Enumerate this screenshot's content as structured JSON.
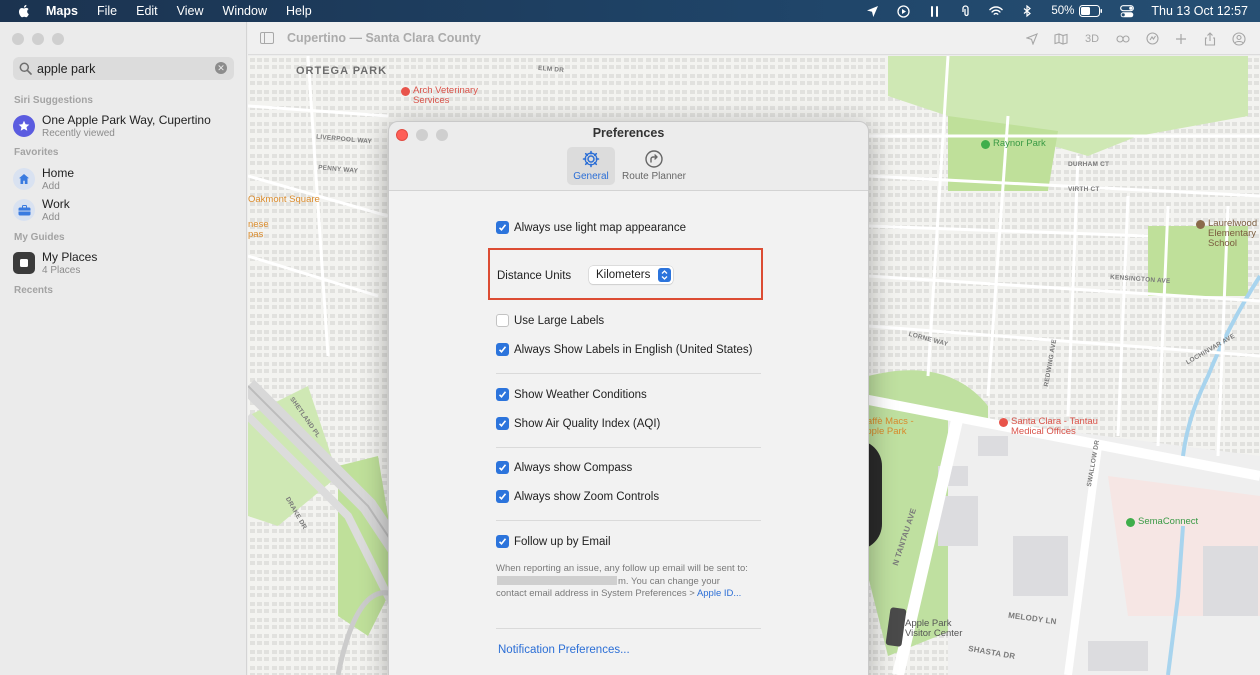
{
  "menubar": {
    "app_name": "Maps",
    "menus": [
      "File",
      "Edit",
      "View",
      "Window",
      "Help"
    ],
    "battery_percent": "50%",
    "datetime": "Thu 13 Oct  12:57"
  },
  "sidebar": {
    "search": {
      "value": "apple park"
    },
    "siri_suggestions_label": "Siri Suggestions",
    "suggestion": {
      "title": "One Apple Park Way, Cupertino",
      "subtitle": "Recently viewed"
    },
    "favorites_label": "Favorites",
    "favorites": [
      {
        "title": "Home",
        "subtitle": "Add"
      },
      {
        "title": "Work",
        "subtitle": "Add"
      }
    ],
    "guides_label": "My Guides",
    "guide": {
      "title": "My Places",
      "subtitle": "4 Places"
    },
    "recents_label": "Recents"
  },
  "toolbar": {
    "title": "Cupertino — Santa Clara County",
    "view_3d_label": "3D"
  },
  "map": {
    "area_labels": [
      "ORTEGA PARK"
    ],
    "pois": [
      {
        "name": "Arch Veterinary Services",
        "color": "#e8544b"
      },
      {
        "name": "Raynor Park",
        "color": "#3fae4b"
      },
      {
        "name": "Laurelwood Elementary School",
        "color": "#8a6a4a"
      },
      {
        "name": "Oakmont Square",
        "color": "#e8962e"
      },
      {
        "name": "Caffè Macs - Apple Park",
        "color": "#e8962e"
      },
      {
        "name": "Santa Clara - Tantau Medical Offices",
        "color": "#e8544b"
      },
      {
        "name": "SemaConnect",
        "color": "#3fae4b"
      },
      {
        "name": "Apple Park Visitor Center",
        "color": "#555555"
      }
    ],
    "street_labels": [
      "N TANTAU AVE",
      "MELODY LN",
      "SHASTA DR",
      "KENSINGTON AVE",
      "SHETLAND PL",
      "DRAKE DR",
      "LOCHINVAR AVE",
      "SWALLOW DR",
      "REDWING AVE",
      "VIRTH CT",
      "DURHAM CT",
      "LORNE WAY",
      "LIVERPOOL WAY",
      "PENNY WAY",
      "ELM DR"
    ],
    "partial_labels": [
      "nese",
      "pas"
    ]
  },
  "preferences": {
    "title": "Preferences",
    "tabs": [
      {
        "label": "General",
        "active": true
      },
      {
        "label": "Route Planner",
        "active": false
      }
    ],
    "light_map": {
      "label": "Always use light map appearance",
      "checked": true
    },
    "distance_units": {
      "label": "Distance Units",
      "value": "Kilometers"
    },
    "large_labels": {
      "label": "Use Large Labels",
      "checked": false
    },
    "english_labels": {
      "label": "Always Show Labels in English (United States)",
      "checked": true
    },
    "weather": {
      "label": "Show Weather Conditions",
      "checked": true
    },
    "aqi": {
      "label": "Show Air Quality Index (AQI)",
      "checked": true
    },
    "compass": {
      "label": "Always show Compass",
      "checked": true
    },
    "zoom": {
      "label": "Always show Zoom Controls",
      "checked": true
    },
    "follow_up": {
      "label": "Follow up by Email",
      "checked": true
    },
    "note": {
      "line1": "When reporting an issue, any follow up email will be sent to:",
      "line1_end": "m. You can change your contact email address in System Preferences >",
      "link": "Apple ID..."
    },
    "notification_link": "Notification Preferences..."
  }
}
